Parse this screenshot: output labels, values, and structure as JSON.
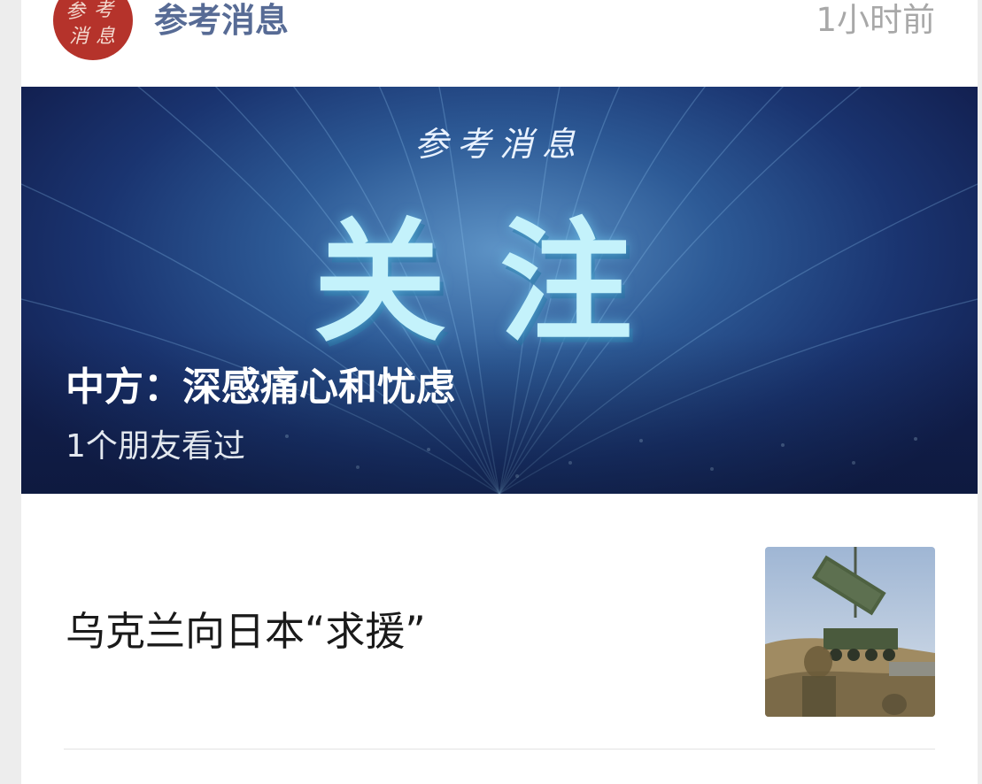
{
  "header": {
    "account_name": "参考消息",
    "timestamp": "1小时前",
    "avatar_glyphs": [
      "参",
      "考",
      "消",
      "息"
    ]
  },
  "banner": {
    "logo_text": "参考消息",
    "big_word": "关注",
    "headline": "中方：深感痛心和忧虑",
    "meta": "1个朋友看过"
  },
  "article": {
    "title": "乌克兰向日本“求援”",
    "thumbnail_icon": "missile-launcher-photo"
  },
  "colors": {
    "account_name": "#576b95",
    "avatar_bg": "#b5332b",
    "banner_bg": "#1a3470",
    "banner_word": "#c4f2fb"
  }
}
